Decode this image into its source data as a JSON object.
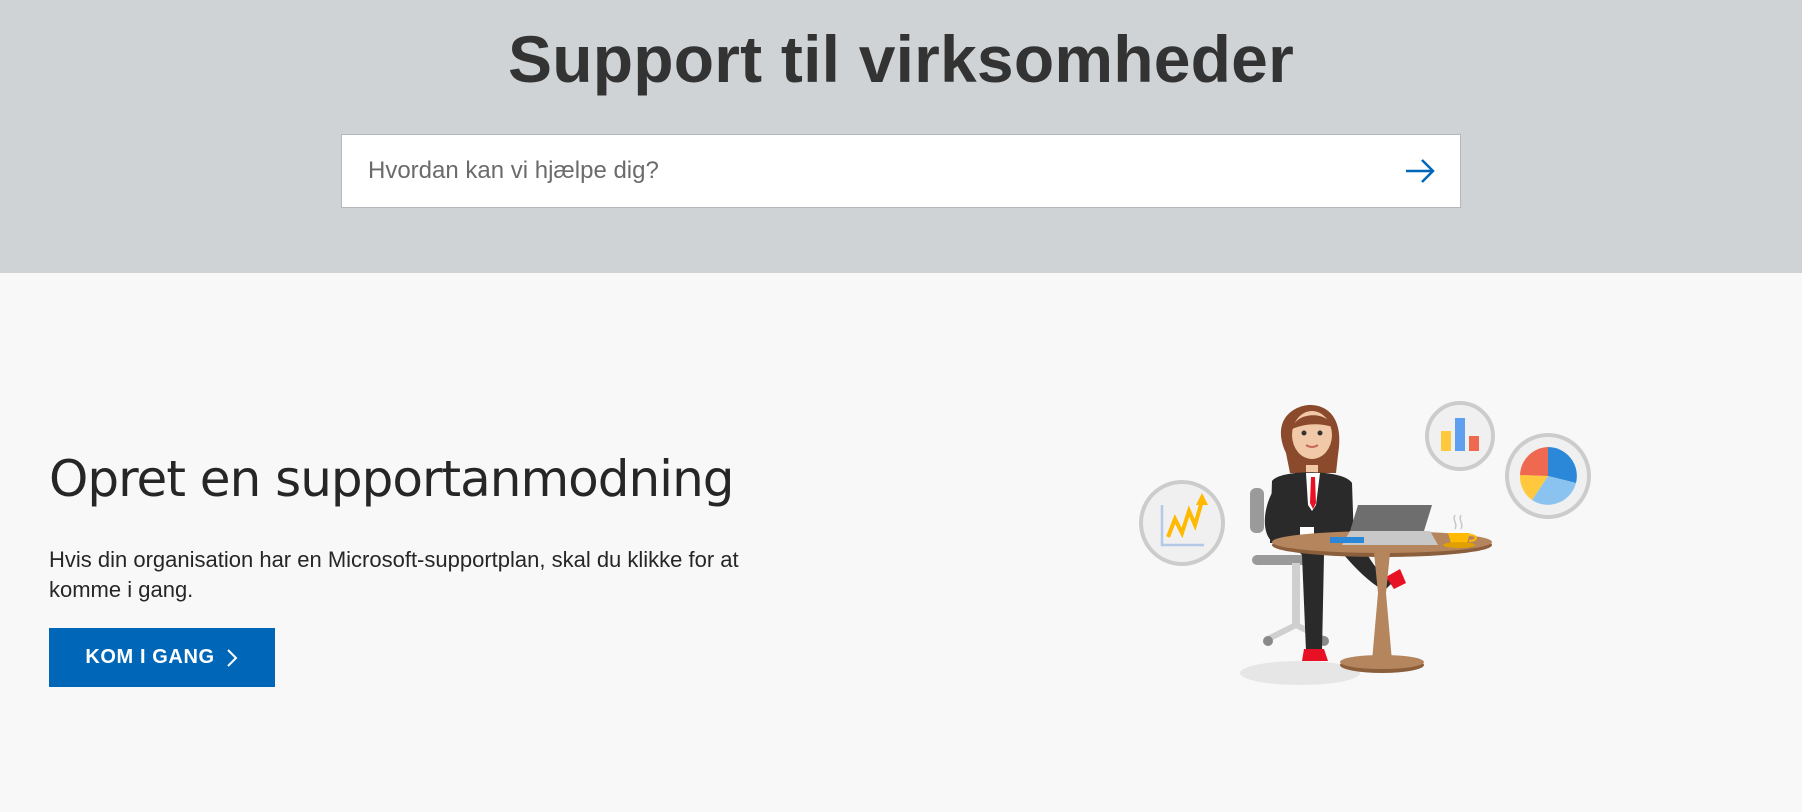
{
  "hero": {
    "title": "Support til virksomheder",
    "search": {
      "placeholder": "Hvordan kan vi hjælpe dig?",
      "submit_icon": "arrow-right-icon"
    }
  },
  "main": {
    "title": "Opret en supportanmodning",
    "description": "Hvis din organisation har en Microsoft-supportplan, skal du klikke for at komme i gang.",
    "cta_label": "KOM I GANG",
    "cta_icon": "chevron-right-icon"
  },
  "colors": {
    "hero_bg": "#d0d3d5",
    "page_bg": "#f8f8f8",
    "accent": "#0067b8",
    "text": "#262626"
  }
}
